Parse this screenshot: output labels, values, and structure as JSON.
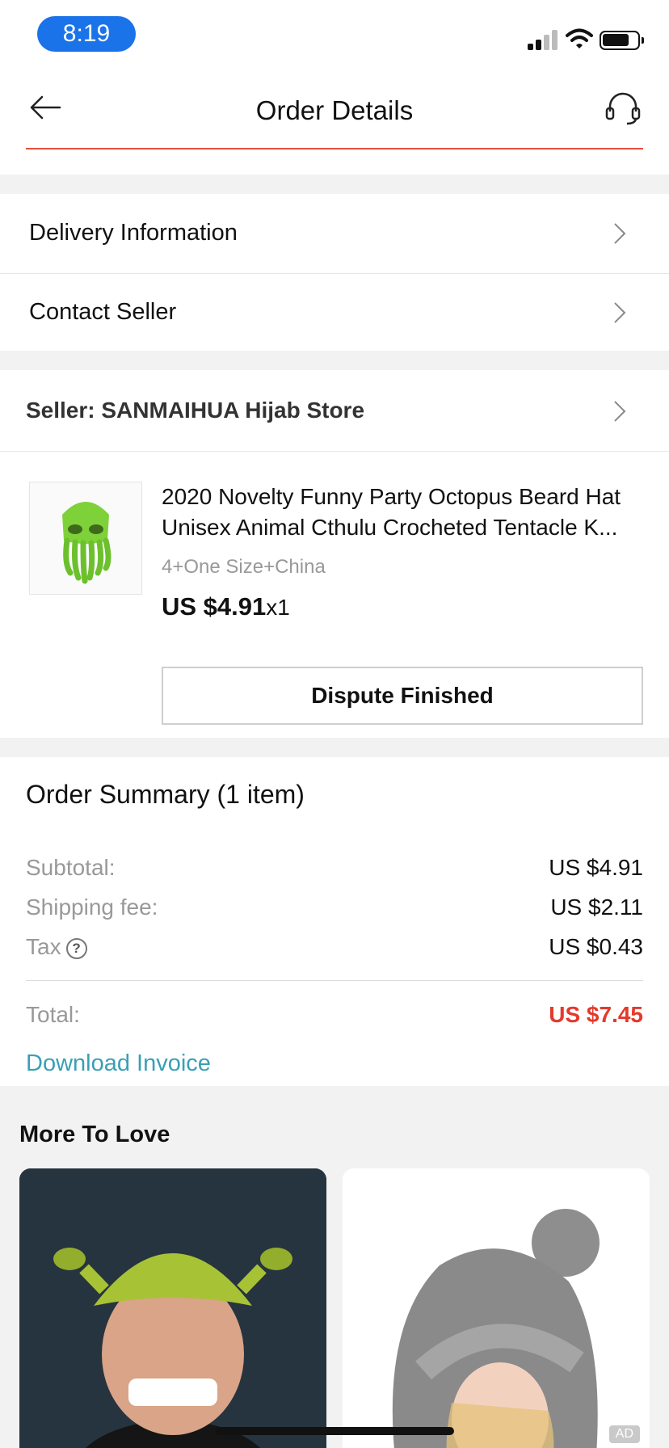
{
  "status_bar": {
    "time": "8:19"
  },
  "header": {
    "title": "Order Details"
  },
  "menu": {
    "delivery_label": "Delivery Information",
    "contact_label": "Contact Seller"
  },
  "seller": {
    "label": "Seller: SANMAIHUA Hijab Store"
  },
  "product": {
    "title_line1": "2020 Novelty Funny Party Octopus Beard Hat",
    "title_line2": "Unisex Animal Cthulu Crocheted Tentacle K...",
    "variant": "4+One Size+China",
    "price": "US $4.91",
    "quantity": "x1",
    "action_label": "Dispute Finished"
  },
  "summary": {
    "title": "Order Summary (1 item)",
    "subtotal_label": "Subtotal:",
    "subtotal_value": "US $4.91",
    "shipping_label": "Shipping fee:",
    "shipping_value": "US $2.11",
    "tax_label": "Tax",
    "tax_help": "?",
    "tax_value": "US $0.43",
    "total_label": "Total:",
    "total_value": "US $7.45",
    "invoice_link": "Download Invoice"
  },
  "recommendations": {
    "title": "More To Love",
    "ad_badge": "AD"
  },
  "colors": {
    "accent_red": "#e4392b",
    "link_teal": "#3a9fb5",
    "time_pill_blue": "#1a73e8"
  }
}
